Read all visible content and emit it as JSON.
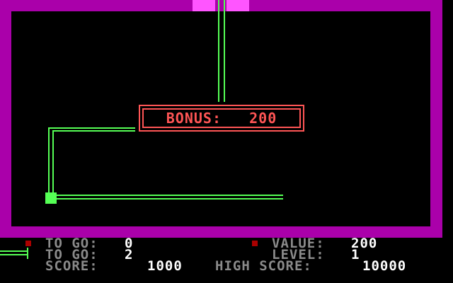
{
  "bonus": {
    "label": "BONUS:",
    "value": "200"
  },
  "hud": {
    "left": {
      "row1_label": "TO GO:",
      "row1_value": "0",
      "row2_label": "TO GO:",
      "row2_value": "2",
      "score_label": "SCORE:",
      "score_value": "1000"
    },
    "right": {
      "value_label": "VALUE:",
      "value_value": "200",
      "level_label": "LEVEL:",
      "level_value": "1",
      "high_score_label": "HIGH SCORE:",
      "high_score_value": "10000"
    }
  },
  "colors": {
    "border": "#aa00aa",
    "gate": "#ff55ff",
    "line": "#55ff55",
    "bonus": "#ff5555",
    "background": "#000000"
  }
}
